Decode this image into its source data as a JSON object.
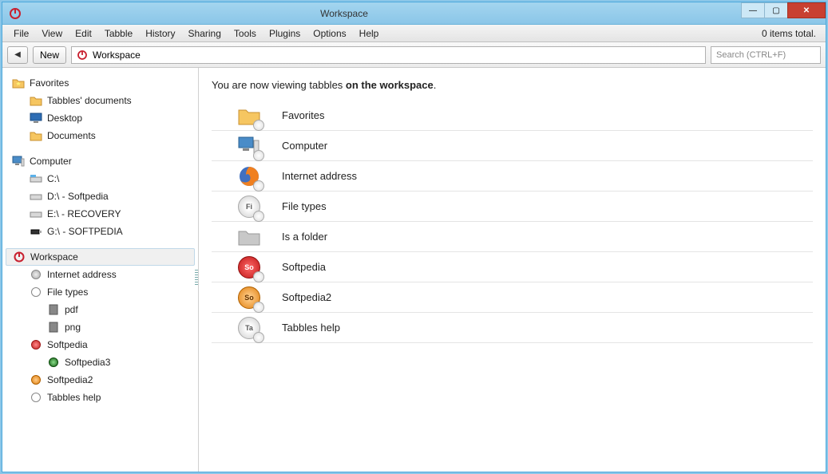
{
  "titlebar": {
    "title": "Workspace"
  },
  "window_controls": {
    "min": "—",
    "max": "▢",
    "close": "✕"
  },
  "menubar": {
    "items": [
      "File",
      "View",
      "Edit",
      "Tabble",
      "History",
      "Sharing",
      "Tools",
      "Plugins",
      "Options",
      "Help"
    ],
    "status": "0 items total."
  },
  "toolbar": {
    "back_icon": "◀",
    "new_label": "New",
    "address_text": "Workspace",
    "search_placeholder": "Search (CTRL+F)"
  },
  "sidebar": {
    "groups": [
      {
        "label": "Favorites",
        "icon": "favorites-folder",
        "children": [
          {
            "label": "Tabbles' documents",
            "icon": "folder"
          },
          {
            "label": "Desktop",
            "icon": "desktop"
          },
          {
            "label": "Documents",
            "icon": "folder"
          }
        ]
      },
      {
        "label": "Computer",
        "icon": "computer",
        "children": [
          {
            "label": "C:\\",
            "icon": "drive-c"
          },
          {
            "label": "D:\\ - Softpedia",
            "icon": "drive"
          },
          {
            "label": "E:\\ - RECOVERY",
            "icon": "drive"
          },
          {
            "label": "G:\\ - SOFTPEDIA",
            "icon": "usb"
          }
        ]
      },
      {
        "label": "Workspace",
        "icon": "workspace",
        "selected": true,
        "children": [
          {
            "label": "Internet address",
            "icon": "circle-gray"
          },
          {
            "label": "File types",
            "icon": "circle-empty",
            "children": [
              {
                "label": "pdf",
                "icon": "file"
              },
              {
                "label": "png",
                "icon": "file"
              }
            ]
          },
          {
            "label": "Softpedia",
            "icon": "circle-red",
            "children": [
              {
                "label": "Softpedia3",
                "icon": "circle-green"
              }
            ]
          },
          {
            "label": "Softpedia2",
            "icon": "circle-orange"
          },
          {
            "label": "Tabbles help",
            "icon": "circle-empty"
          }
        ]
      }
    ]
  },
  "main": {
    "heading_prefix": "You are now viewing tabbles ",
    "heading_bold": "on the workspace",
    "heading_suffix": ".",
    "items": [
      {
        "label": "Favorites",
        "icon": "favorites-big"
      },
      {
        "label": "Computer",
        "icon": "computer-big"
      },
      {
        "label": "Internet address",
        "icon": "firefox"
      },
      {
        "label": "File types",
        "icon": "circle-gray-text",
        "text": "Fi"
      },
      {
        "label": "Is a folder",
        "icon": "folder-gray"
      },
      {
        "label": "Softpedia",
        "icon": "circle-red-text",
        "text": "So"
      },
      {
        "label": "Softpedia2",
        "icon": "circle-orange-text",
        "text": "So"
      },
      {
        "label": "Tabbles help",
        "icon": "circle-gray-text",
        "text": "Ta"
      }
    ]
  }
}
